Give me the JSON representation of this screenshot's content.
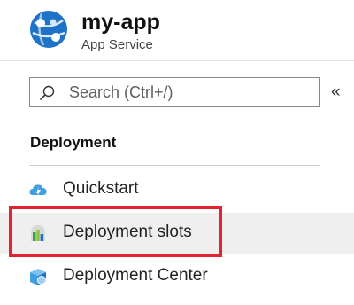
{
  "header": {
    "title": "my-app",
    "subtitle": "App Service",
    "icon": "app-service-globe-icon"
  },
  "search": {
    "placeholder": "Search (Ctrl+/)",
    "collapse_glyph": "«"
  },
  "section": {
    "heading": "Deployment"
  },
  "menu": {
    "items": [
      {
        "label": "Quickstart",
        "icon": "quickstart-cloud-icon",
        "selected": false
      },
      {
        "label": "Deployment slots",
        "icon": "deployment-slots-icon",
        "selected": true
      },
      {
        "label": "Deployment Center",
        "icon": "deployment-center-icon",
        "selected": false
      }
    ]
  },
  "colors": {
    "highlight": "#e02530",
    "selected_bg": "#efefef",
    "brand_blue": "#1e73c9"
  }
}
